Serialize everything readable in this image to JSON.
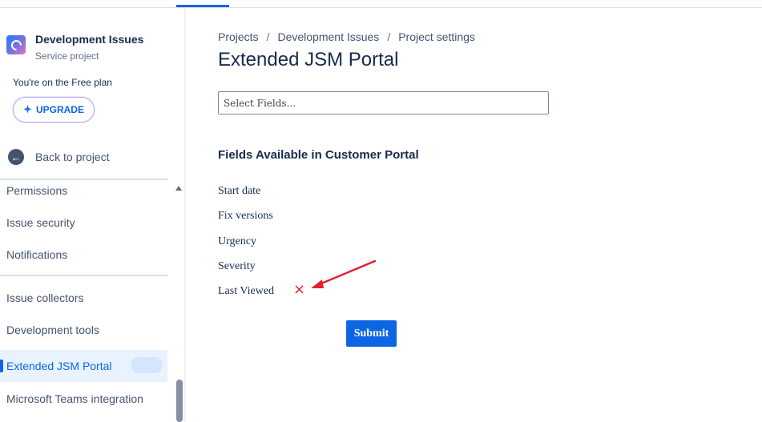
{
  "project": {
    "name": "Development Issues",
    "type": "Service project",
    "plan_text": "You're on the Free plan",
    "upgrade_label": "UPGRADE"
  },
  "sidebar": {
    "back_label": "Back to project",
    "items": [
      {
        "label": "Permissions"
      },
      {
        "label": "Issue security"
      },
      {
        "label": "Notifications"
      },
      {
        "label": "Issue collectors"
      },
      {
        "label": "Development tools"
      },
      {
        "label": "Extended JSM Portal",
        "active": true
      },
      {
        "label": "Microsoft Teams integration"
      }
    ]
  },
  "breadcrumb": [
    "Projects",
    "Development Issues",
    "Project settings"
  ],
  "page": {
    "title": "Extended JSM Portal",
    "select_placeholder": "Select Fields...",
    "section_title": "Fields Available in Customer Portal",
    "fields": [
      "Start date",
      "Fix versions",
      "Urgency",
      "Severity",
      "Last Viewed"
    ],
    "remove_icon": "×",
    "submit_label": "Submit"
  },
  "colors": {
    "accent": "#0c66e4",
    "annotation_red": "#e2202f"
  }
}
